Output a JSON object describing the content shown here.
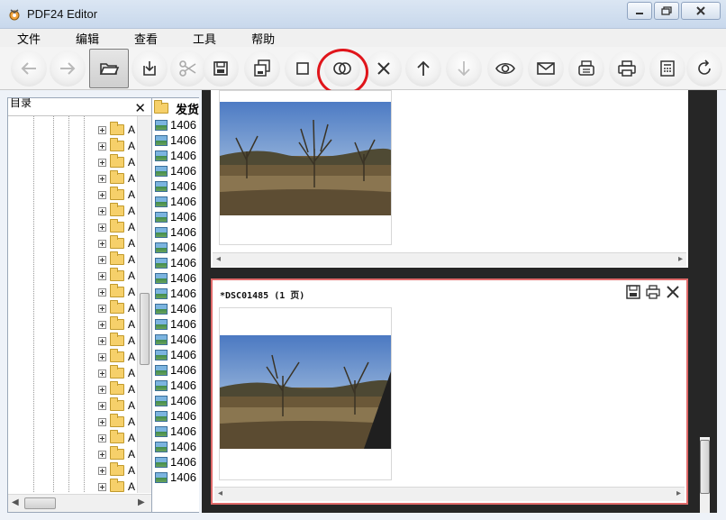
{
  "window": {
    "title": "PDF24 Editor",
    "controls": [
      "minimize",
      "maximize",
      "close"
    ]
  },
  "menu": {
    "items": [
      "文件",
      "编辑",
      "查看",
      "工具",
      "帮助"
    ]
  },
  "toolbar": {
    "buttons": [
      {
        "name": "back-arrow-icon"
      },
      {
        "name": "forward-arrow-icon"
      },
      {
        "name": "open-folder-icon",
        "pressed": true
      },
      {
        "name": "import-icon"
      },
      {
        "name": "scissors-icon"
      },
      {
        "name": "save-icon"
      },
      {
        "name": "save-as-icon"
      },
      {
        "name": "square-icon"
      },
      {
        "name": "merge-icon",
        "highlighted": true
      },
      {
        "name": "delete-icon"
      },
      {
        "name": "up-arrow-icon"
      },
      {
        "name": "down-arrow-icon"
      },
      {
        "name": "eye-icon"
      },
      {
        "name": "mail-icon"
      },
      {
        "name": "fax-icon"
      },
      {
        "name": "printer-icon"
      },
      {
        "name": "calculator-icon"
      },
      {
        "name": "rotate-icon"
      }
    ],
    "highlight_color": "#e0151b"
  },
  "left_panel": {
    "header_label": "目录",
    "close_symbol": "✕",
    "folder_label": "A",
    "row_count": 24
  },
  "middle_panel": {
    "header_label": "发货",
    "file_label": "1406",
    "row_count": 24
  },
  "doc_panels": [
    {
      "title": "",
      "pages": 1
    },
    {
      "title": "*DSC01485 (1 页)",
      "pages": 1,
      "active": true
    }
  ],
  "colors": {
    "workspace_bg": "#262626",
    "active_panel_border": "#e06a6a"
  }
}
